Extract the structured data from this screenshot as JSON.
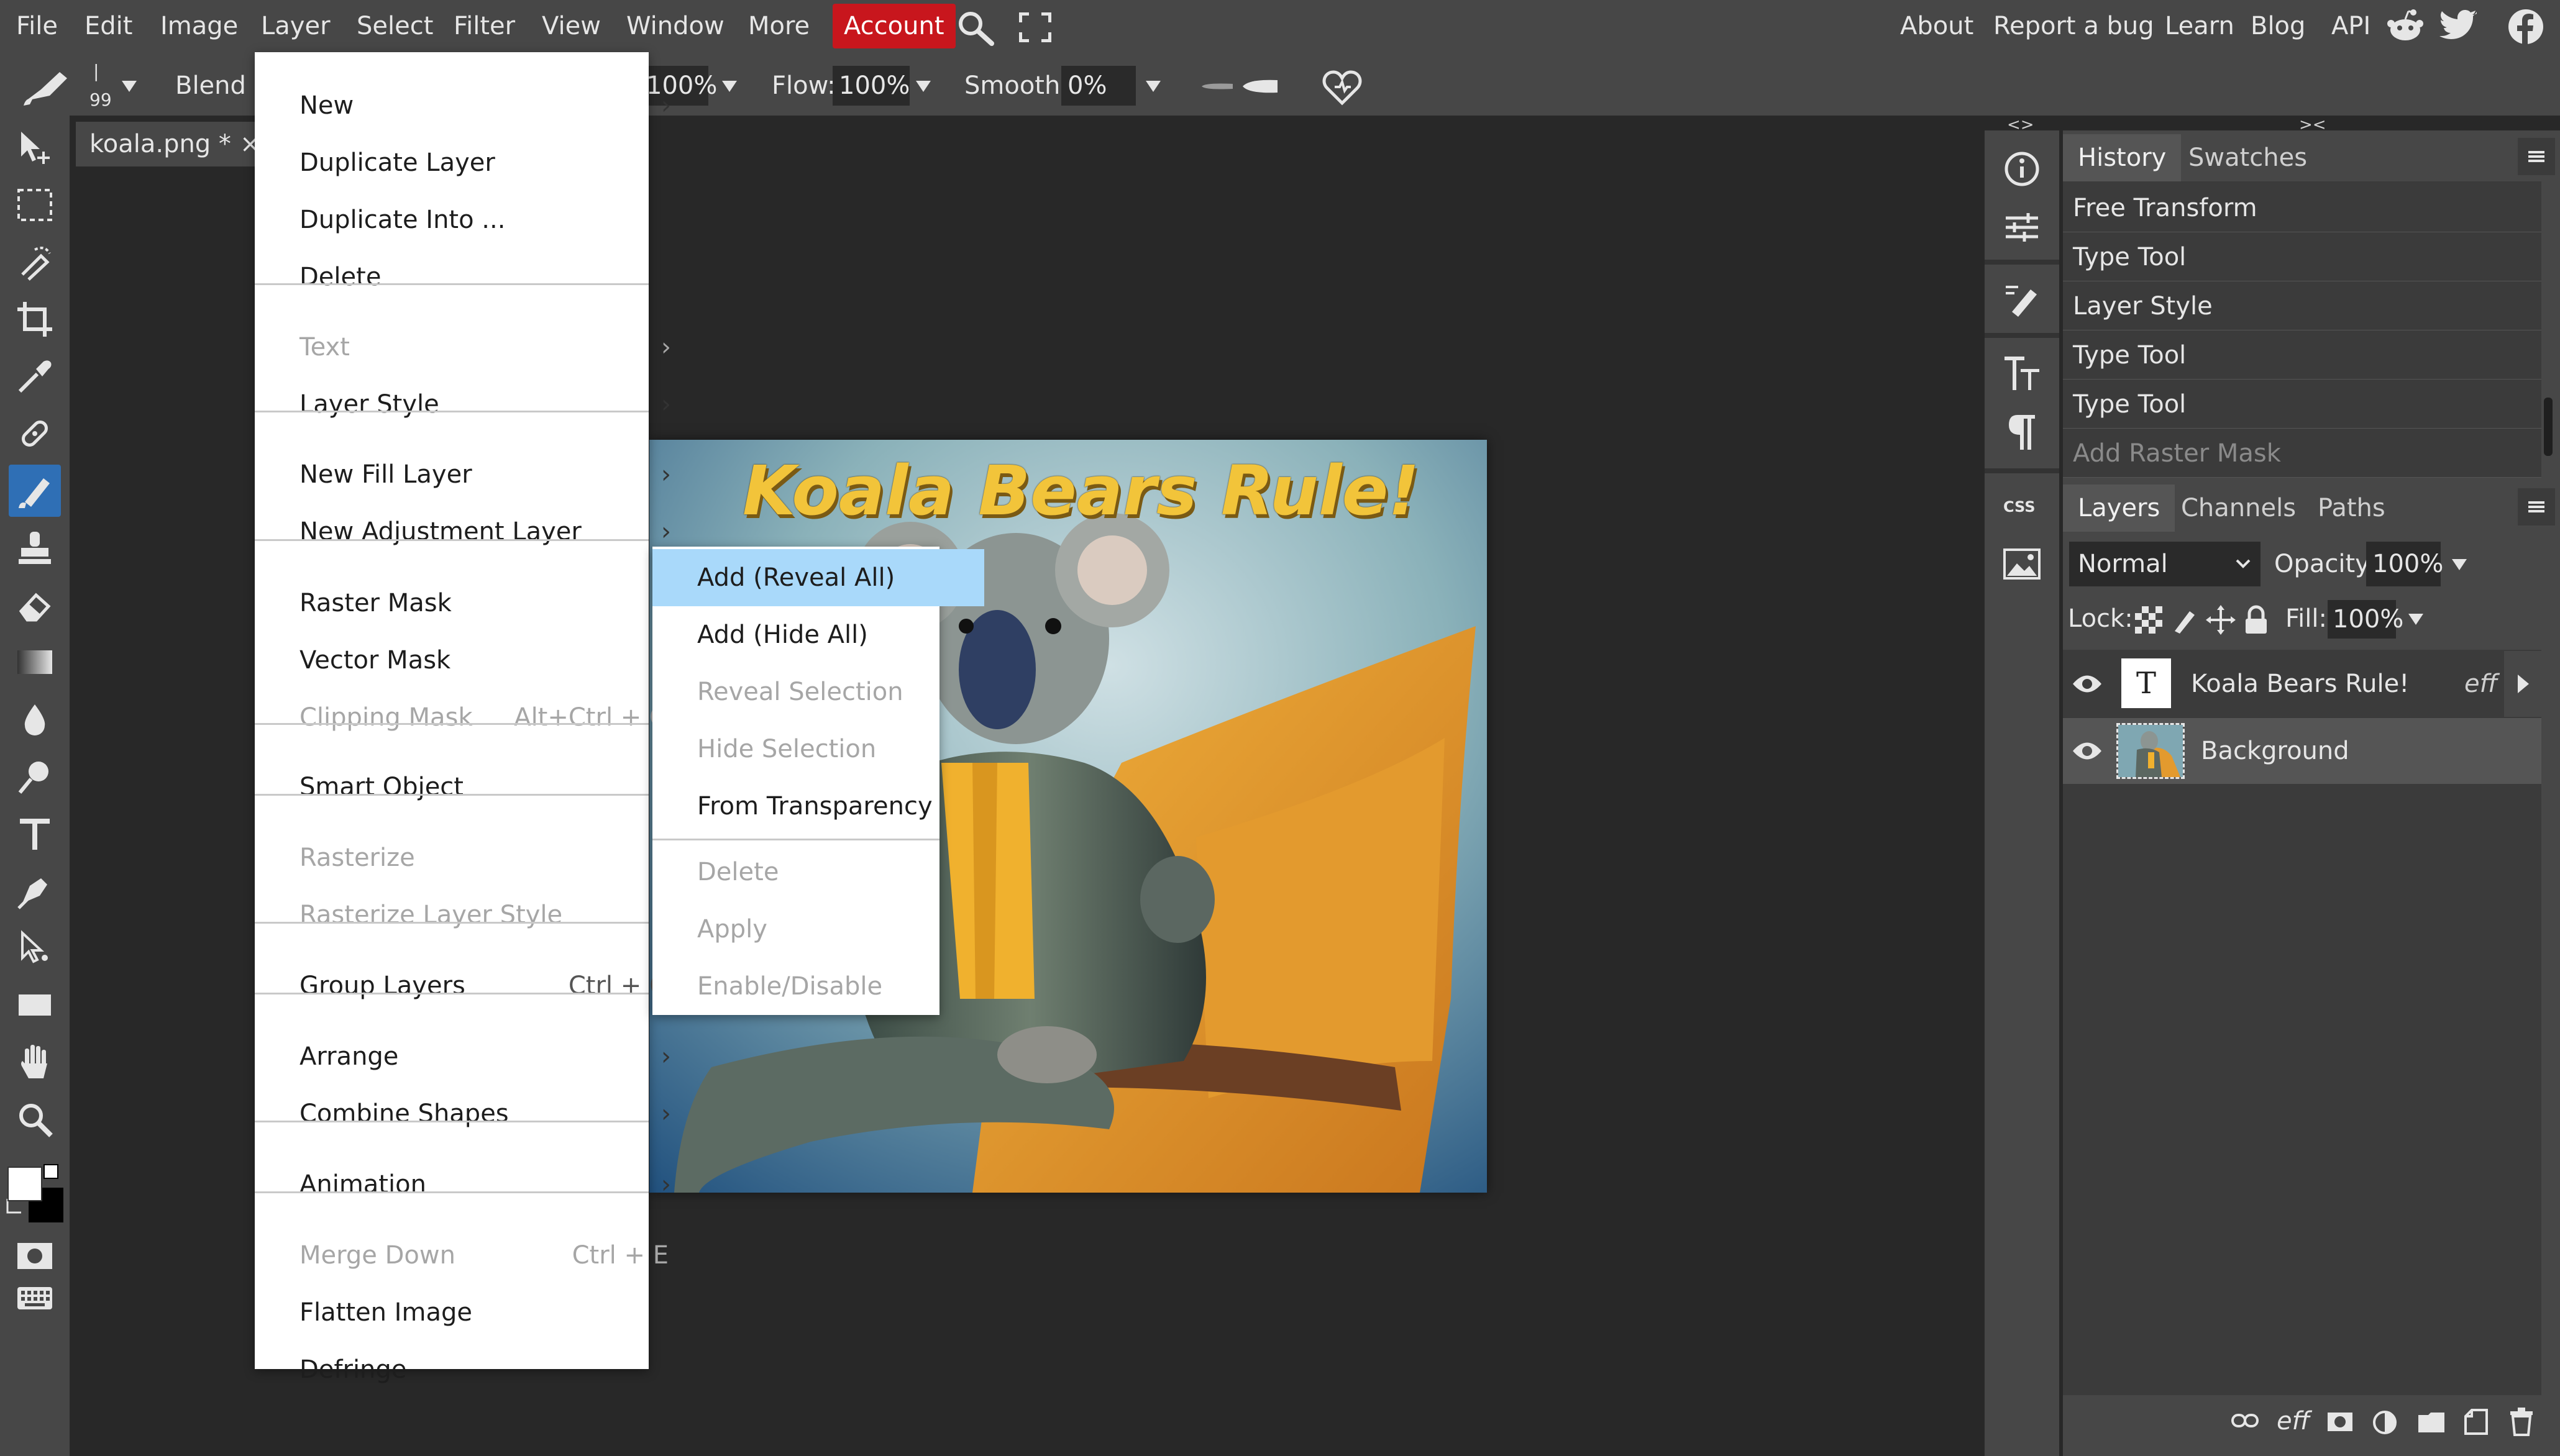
{
  "menubar": {
    "items": [
      "File",
      "Edit",
      "Image",
      "Layer",
      "Select",
      "Filter",
      "View",
      "Window",
      "More"
    ],
    "account": "Account",
    "links": [
      "About",
      "Report a bug",
      "Learn",
      "Blog",
      "API"
    ],
    "icons": [
      "search-icon",
      "fullscreen-icon",
      "reddit-icon",
      "twitter-icon",
      "facebook-icon"
    ],
    "account_color": "#c8161d"
  },
  "options": {
    "brush_size_top": "|",
    "brush_size": "99",
    "blend_label": "Blend M",
    "opacity_value": "100%",
    "flow_label": "Flow:",
    "flow_value": "100%",
    "smooth_label": "Smooth:",
    "smooth_value": "0%"
  },
  "doc_tab": {
    "title": "koala.png *",
    "close": "×"
  },
  "canvas": {
    "headline": "Koala Bears Rule!"
  },
  "layer_menu": {
    "items": [
      {
        "label": "New",
        "arrow": "›"
      },
      {
        "label": "Duplicate Layer"
      },
      {
        "label": "Duplicate Into ..."
      },
      {
        "label": "Delete"
      },
      {
        "label": "Text",
        "arrow": "›",
        "disabled": true
      },
      {
        "label": "Layer Style",
        "arrow": "›"
      },
      {
        "label": "New Fill Layer",
        "arrow": "›"
      },
      {
        "label": "New Adjustment Layer",
        "arrow": "›"
      },
      {
        "label": "Raster Mask",
        "arrow": "›"
      },
      {
        "label": "Vector Mask",
        "arrow": "›"
      },
      {
        "label": "Clipping Mask",
        "shortcut": "Alt+Ctrl + G",
        "disabled": true
      },
      {
        "label": "Smart Object",
        "arrow": "›"
      },
      {
        "label": "Rasterize",
        "disabled": true
      },
      {
        "label": "Rasterize Layer Style",
        "disabled": true
      },
      {
        "label": "Group Layers",
        "shortcut": "Ctrl + G"
      },
      {
        "label": "Arrange",
        "arrow": "›"
      },
      {
        "label": "Combine Shapes",
        "arrow": "›"
      },
      {
        "label": "Animation",
        "arrow": "›"
      },
      {
        "label": "Merge Down",
        "shortcut": "Ctrl + E",
        "disabled": true
      },
      {
        "label": "Flatten Image"
      },
      {
        "label": "Defringe"
      }
    ]
  },
  "raster_submenu": {
    "items": [
      {
        "label": "Add (Reveal All)",
        "highlighted": true
      },
      {
        "label": "Add (Hide All)"
      },
      {
        "label": "Reveal Selection",
        "disabled": true
      },
      {
        "label": "Hide Selection",
        "disabled": true
      },
      {
        "label": "From Transparency"
      },
      {
        "label": "Delete",
        "disabled": true
      },
      {
        "label": "Apply",
        "disabled": true
      },
      {
        "label": "Enable/Disable",
        "disabled": true
      }
    ]
  },
  "history_panel": {
    "tabs": [
      "History",
      "Swatches"
    ],
    "items": [
      {
        "label": "Free Transform"
      },
      {
        "label": "Type Tool"
      },
      {
        "label": "Layer Style"
      },
      {
        "label": "Type Tool"
      },
      {
        "label": "Type Tool"
      },
      {
        "label": "Add Raster Mask",
        "dimmed": true
      }
    ]
  },
  "layers_panel": {
    "tabs": [
      "Layers",
      "Channels",
      "Paths"
    ],
    "blend_mode": "Normal",
    "opacity_label": "Opacity:",
    "opacity_value": "100%",
    "lock_label": "Lock:",
    "fill_label": "Fill:",
    "fill_value": "100%",
    "layers": [
      {
        "name": "Koala Bears Rule!",
        "thumb": "T",
        "fx": "eff",
        "selected": false
      },
      {
        "name": "Background",
        "selected": true
      }
    ],
    "footer_fx": "eff"
  },
  "panel_collapse": {
    "left": "<>",
    "right": "><"
  }
}
